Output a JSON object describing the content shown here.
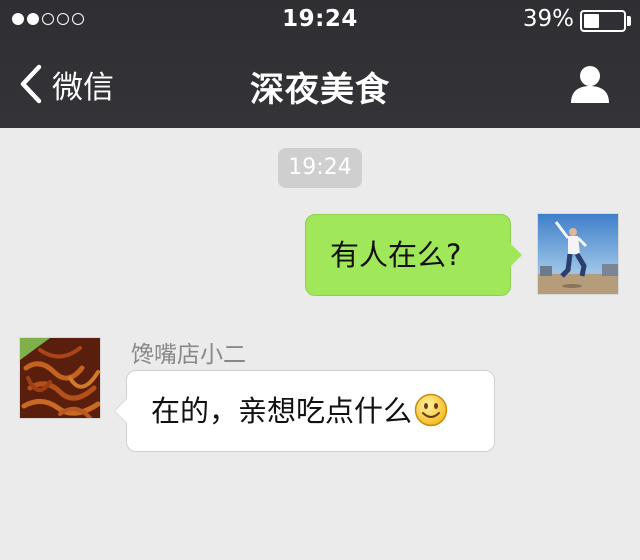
{
  "status_bar": {
    "signal_total": 5,
    "signal_filled": 2,
    "time": "19:24",
    "battery_percent": "39%",
    "battery_level": 0.39
  },
  "nav": {
    "back_label": "微信",
    "title": "深夜美食",
    "profile_icon": "person-icon"
  },
  "chat": {
    "timestamp": "19:24",
    "messages": [
      {
        "direction": "outgoing",
        "text": "有人在么?",
        "avatar": "user-photo-jumping-man"
      },
      {
        "direction": "incoming",
        "sender": "馋嘴店小二",
        "text": "在的，亲想吃点什么",
        "emoji": "smiley-icon",
        "avatar": "food-photo-spicy-strips"
      }
    ]
  },
  "colors": {
    "header_bg": "#333337",
    "chat_bg": "#ebebeb",
    "outgoing_bubble": "#a0e75a",
    "incoming_bubble": "#ffffff",
    "time_chip": "#cfcfcf"
  }
}
